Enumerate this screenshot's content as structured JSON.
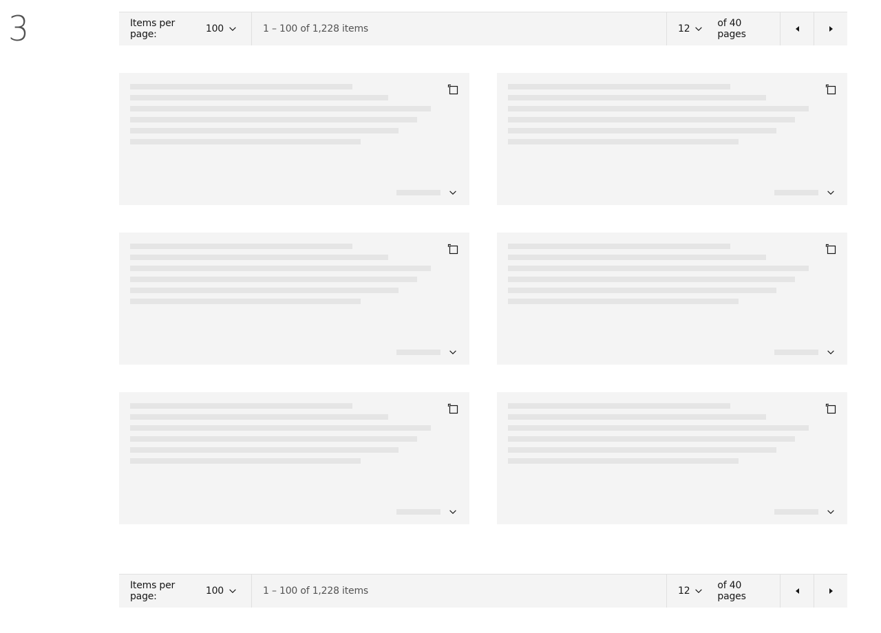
{
  "step": {
    "number": "3"
  },
  "pagination_top": {
    "items_per_page_label": "Items per page:",
    "items_per_page_value": "100",
    "range_text": "1 – 100 of 1,228 items",
    "current_page": "12",
    "total_pages_text": "of 40 pages",
    "prev_icon": "caret-left-icon",
    "next_icon": "caret-right-icon"
  },
  "pagination_bottom": {
    "items_per_page_label": "Items per page:",
    "items_per_page_value": "100",
    "range_text": "1 – 100 of 1,228 items",
    "current_page": "12",
    "total_pages_text": "of 40 pages",
    "prev_icon": "caret-left-icon",
    "next_icon": "caret-right-icon"
  },
  "cards": {
    "count": 6,
    "state": "loading-skeleton",
    "copy_icon": "copy-icon",
    "expand_icon": "chevron-down-icon"
  },
  "colors": {
    "card_background": "#f4f4f4",
    "skeleton": "#e5e5e5",
    "pagination_background": "#f4f4f4",
    "border": "#e0e0e0",
    "text_primary": "#161616",
    "text_secondary": "#525252"
  }
}
